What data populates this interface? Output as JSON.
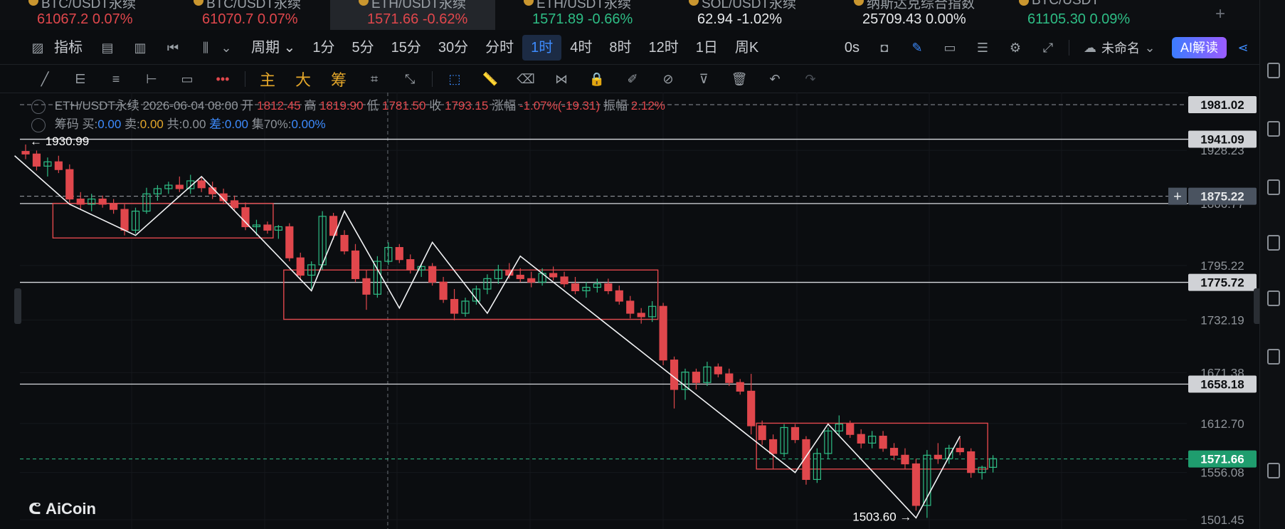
{
  "tickers": [
    {
      "name": "BTC/USDT永续",
      "price": "61067.2",
      "change": "0.07%",
      "dir": "down"
    },
    {
      "name": "BTC/USDT永续",
      "price": "61070.7",
      "change": "0.07%",
      "dir": "down"
    },
    {
      "name": "ETH/USDT永续",
      "price": "1571.66",
      "change": "-0.62%",
      "dir": "down",
      "active": true
    },
    {
      "name": "ETH/USDT永续",
      "price": "1571.89",
      "change": "-0.66%",
      "dir": "up"
    },
    {
      "name": "SOL/USDT永续",
      "price": "62.94",
      "change": "-1.02%",
      "dir": "white"
    },
    {
      "name": "纳斯达克综合指数",
      "price": "25709.43",
      "change": "0.00%",
      "dir": "white"
    },
    {
      "name": "BTC/USDT",
      "price": "61105.30",
      "change": "0.09%",
      "dir": "up"
    }
  ],
  "toolbar": {
    "indicator_label": "指标",
    "period_label": "周期",
    "intervals": [
      "1分",
      "5分",
      "15分",
      "30分",
      "分时",
      "1时",
      "4时",
      "8时",
      "12时",
      "1日",
      "周K"
    ],
    "selected_interval": "1时",
    "countdown": "0s",
    "layout_name": "未命名",
    "ai_label": "AI解读"
  },
  "toolbar2": {
    "zhu": "主",
    "da": "大",
    "chou": "筹"
  },
  "legend": {
    "symbol": "ETH/USDT永续",
    "datetime": "2026-06-04 08:00",
    "open_label": "开",
    "open": "1812.45",
    "high_label": "高",
    "high": "1819.90",
    "low_label": "低",
    "low": "1781.50",
    "close_label": "收",
    "close": "1793.15",
    "change_label": "涨幅",
    "change": "-1.07%(-19.31)",
    "amp_label": "振幅",
    "amp": "2.12%"
  },
  "legend2": {
    "title": "筹码",
    "buy_label": "买:",
    "buy": "0.00",
    "sell_label": "卖:",
    "sell": "0.00",
    "total_label": "共:",
    "total": "0.00",
    "diff_label": "差:",
    "diff": "0.00",
    "conc_label": "集70%:",
    "conc": "0.00%"
  },
  "chart_data": {
    "type": "candlestick",
    "symbol": "ETH/USDT永续",
    "interval": "1h",
    "ylim": [
      1490,
      2000
    ],
    "y_ticks": [
      "1928.23",
      "1866.77",
      "1795.22",
      "1732.19",
      "1671.38",
      "1612.70",
      "1556.08",
      "1501.45"
    ],
    "candles": [
      {
        "o": 1927,
        "h": 1935,
        "l": 1918,
        "c": 1924
      },
      {
        "o": 1924,
        "h": 1928,
        "l": 1905,
        "c": 1910
      },
      {
        "o": 1910,
        "h": 1920,
        "l": 1898,
        "c": 1915
      },
      {
        "o": 1915,
        "h": 1922,
        "l": 1902,
        "c": 1906
      },
      {
        "o": 1906,
        "h": 1912,
        "l": 1868,
        "c": 1872
      },
      {
        "o": 1872,
        "h": 1880,
        "l": 1860,
        "c": 1866
      },
      {
        "o": 1866,
        "h": 1878,
        "l": 1858,
        "c": 1872
      },
      {
        "o": 1872,
        "h": 1876,
        "l": 1862,
        "c": 1866
      },
      {
        "o": 1866,
        "h": 1872,
        "l": 1855,
        "c": 1860
      },
      {
        "o": 1860,
        "h": 1866,
        "l": 1830,
        "c": 1836
      },
      {
        "o": 1836,
        "h": 1862,
        "l": 1832,
        "c": 1858
      },
      {
        "o": 1858,
        "h": 1885,
        "l": 1855,
        "c": 1878
      },
      {
        "o": 1878,
        "h": 1888,
        "l": 1870,
        "c": 1884
      },
      {
        "o": 1884,
        "h": 1892,
        "l": 1878,
        "c": 1888
      },
      {
        "o": 1888,
        "h": 1898,
        "l": 1880,
        "c": 1884
      },
      {
        "o": 1884,
        "h": 1900,
        "l": 1878,
        "c": 1893
      },
      {
        "o": 1893,
        "h": 1898,
        "l": 1880,
        "c": 1885
      },
      {
        "o": 1885,
        "h": 1892,
        "l": 1872,
        "c": 1878
      },
      {
        "o": 1878,
        "h": 1884,
        "l": 1866,
        "c": 1870
      },
      {
        "o": 1870,
        "h": 1876,
        "l": 1858,
        "c": 1862
      },
      {
        "o": 1862,
        "h": 1868,
        "l": 1836,
        "c": 1840
      },
      {
        "o": 1840,
        "h": 1848,
        "l": 1830,
        "c": 1842
      },
      {
        "o": 1842,
        "h": 1846,
        "l": 1832,
        "c": 1836
      },
      {
        "o": 1836,
        "h": 1842,
        "l": 1826,
        "c": 1840
      },
      {
        "o": 1840,
        "h": 1844,
        "l": 1800,
        "c": 1804
      },
      {
        "o": 1804,
        "h": 1810,
        "l": 1778,
        "c": 1784
      },
      {
        "o": 1784,
        "h": 1800,
        "l": 1768,
        "c": 1796
      },
      {
        "o": 1796,
        "h": 1858,
        "l": 1790,
        "c": 1852
      },
      {
        "o": 1852,
        "h": 1856,
        "l": 1825,
        "c": 1830
      },
      {
        "o": 1830,
        "h": 1836,
        "l": 1808,
        "c": 1812
      },
      {
        "o": 1812,
        "h": 1820,
        "l": 1776,
        "c": 1780
      },
      {
        "o": 1780,
        "h": 1790,
        "l": 1744,
        "c": 1762
      },
      {
        "o": 1762,
        "h": 1806,
        "l": 1758,
        "c": 1800
      },
      {
        "o": 1800,
        "h": 1822,
        "l": 1796,
        "c": 1816
      },
      {
        "o": 1816,
        "h": 1820,
        "l": 1798,
        "c": 1802
      },
      {
        "o": 1802,
        "h": 1808,
        "l": 1786,
        "c": 1790
      },
      {
        "o": 1790,
        "h": 1796,
        "l": 1782,
        "c": 1794
      },
      {
        "o": 1794,
        "h": 1798,
        "l": 1772,
        "c": 1776
      },
      {
        "o": 1776,
        "h": 1782,
        "l": 1752,
        "c": 1756
      },
      {
        "o": 1756,
        "h": 1768,
        "l": 1732,
        "c": 1740
      },
      {
        "o": 1740,
        "h": 1758,
        "l": 1736,
        "c": 1754
      },
      {
        "o": 1754,
        "h": 1772,
        "l": 1750,
        "c": 1768
      },
      {
        "o": 1768,
        "h": 1785,
        "l": 1762,
        "c": 1780
      },
      {
        "o": 1780,
        "h": 1796,
        "l": 1774,
        "c": 1790
      },
      {
        "o": 1790,
        "h": 1798,
        "l": 1780,
        "c": 1784
      },
      {
        "o": 1784,
        "h": 1792,
        "l": 1776,
        "c": 1780
      },
      {
        "o": 1780,
        "h": 1788,
        "l": 1770,
        "c": 1776
      },
      {
        "o": 1776,
        "h": 1792,
        "l": 1772,
        "c": 1786
      },
      {
        "o": 1786,
        "h": 1794,
        "l": 1778,
        "c": 1782
      },
      {
        "o": 1782,
        "h": 1788,
        "l": 1770,
        "c": 1774
      },
      {
        "o": 1774,
        "h": 1782,
        "l": 1762,
        "c": 1766
      },
      {
        "o": 1766,
        "h": 1776,
        "l": 1758,
        "c": 1770
      },
      {
        "o": 1770,
        "h": 1780,
        "l": 1764,
        "c": 1774
      },
      {
        "o": 1774,
        "h": 1780,
        "l": 1762,
        "c": 1766
      },
      {
        "o": 1766,
        "h": 1772,
        "l": 1750,
        "c": 1754
      },
      {
        "o": 1754,
        "h": 1760,
        "l": 1734,
        "c": 1740
      },
      {
        "o": 1740,
        "h": 1746,
        "l": 1728,
        "c": 1736
      },
      {
        "o": 1736,
        "h": 1754,
        "l": 1730,
        "c": 1748
      },
      {
        "o": 1748,
        "h": 1752,
        "l": 1680,
        "c": 1686
      },
      {
        "o": 1686,
        "h": 1690,
        "l": 1630,
        "c": 1652
      },
      {
        "o": 1652,
        "h": 1676,
        "l": 1640,
        "c": 1672
      },
      {
        "o": 1672,
        "h": 1676,
        "l": 1652,
        "c": 1660
      },
      {
        "o": 1660,
        "h": 1684,
        "l": 1656,
        "c": 1678
      },
      {
        "o": 1678,
        "h": 1682,
        "l": 1666,
        "c": 1670
      },
      {
        "o": 1670,
        "h": 1676,
        "l": 1656,
        "c": 1660
      },
      {
        "o": 1660,
        "h": 1664,
        "l": 1646,
        "c": 1650
      },
      {
        "o": 1650,
        "h": 1670,
        "l": 1600,
        "c": 1610
      },
      {
        "o": 1610,
        "h": 1616,
        "l": 1588,
        "c": 1594
      },
      {
        "o": 1594,
        "h": 1600,
        "l": 1560,
        "c": 1578
      },
      {
        "o": 1578,
        "h": 1612,
        "l": 1574,
        "c": 1608
      },
      {
        "o": 1608,
        "h": 1612,
        "l": 1590,
        "c": 1594
      },
      {
        "o": 1594,
        "h": 1598,
        "l": 1542,
        "c": 1548
      },
      {
        "o": 1548,
        "h": 1584,
        "l": 1544,
        "c": 1578
      },
      {
        "o": 1578,
        "h": 1608,
        "l": 1572,
        "c": 1604
      },
      {
        "o": 1604,
        "h": 1622,
        "l": 1598,
        "c": 1612
      },
      {
        "o": 1612,
        "h": 1616,
        "l": 1596,
        "c": 1600
      },
      {
        "o": 1600,
        "h": 1606,
        "l": 1584,
        "c": 1590
      },
      {
        "o": 1590,
        "h": 1604,
        "l": 1584,
        "c": 1598
      },
      {
        "o": 1598,
        "h": 1604,
        "l": 1580,
        "c": 1584
      },
      {
        "o": 1584,
        "h": 1590,
        "l": 1570,
        "c": 1576
      },
      {
        "o": 1576,
        "h": 1584,
        "l": 1560,
        "c": 1566
      },
      {
        "o": 1566,
        "h": 1572,
        "l": 1512,
        "c": 1518
      },
      {
        "o": 1518,
        "h": 1582,
        "l": 1503.6,
        "c": 1576
      },
      {
        "o": 1576,
        "h": 1590,
        "l": 1566,
        "c": 1572
      },
      {
        "o": 1572,
        "h": 1588,
        "l": 1566,
        "c": 1584
      },
      {
        "o": 1584,
        "h": 1596,
        "l": 1576,
        "c": 1580
      },
      {
        "o": 1580,
        "h": 1584,
        "l": 1550,
        "c": 1556
      },
      {
        "o": 1556,
        "h": 1564,
        "l": 1548,
        "c": 1562
      },
      {
        "o": 1562,
        "h": 1576,
        "l": 1556,
        "c": 1572
      }
    ],
    "h_lines": [
      1941.09,
      1875.22,
      1866.77,
      1775.72,
      1658.18
    ],
    "current_price": 1571.66,
    "price_labels": [
      {
        "value": 1981.02,
        "text": "1981.02",
        "kind": "gray"
      },
      {
        "value": 1941.09,
        "text": "1941.09",
        "kind": "gray"
      },
      {
        "value": 1875.22,
        "text": "1875.22",
        "kind": "crosshair"
      },
      {
        "value": 1775.72,
        "text": "1775.72",
        "kind": "gray"
      },
      {
        "value": 1658.18,
        "text": "1658.18",
        "kind": "gray"
      },
      {
        "value": 1571.66,
        "text": "1571.66",
        "kind": "current"
      }
    ],
    "annotations": [
      {
        "text": "← 1930.99",
        "value": 1930.99,
        "index": 0,
        "side": "left"
      },
      {
        "text": "1503.60 →",
        "value": 1503.6,
        "index": 81,
        "side": "right"
      }
    ],
    "boxes": [
      {
        "from": 3,
        "to": 22,
        "top": 1867,
        "bottom": 1827
      },
      {
        "from": 24,
        "to": 57,
        "top": 1790,
        "bottom": 1733
      },
      {
        "from": 67,
        "to": 87,
        "top": 1613,
        "bottom": 1560
      }
    ],
    "zigzag": [
      {
        "i": -1,
        "v": 1922
      },
      {
        "i": 4,
        "v": 1866
      },
      {
        "i": 10,
        "v": 1830
      },
      {
        "i": 16,
        "v": 1898
      },
      {
        "i": 26,
        "v": 1766
      },
      {
        "i": 29,
        "v": 1858
      },
      {
        "i": 34,
        "v": 1746
      },
      {
        "i": 37,
        "v": 1822
      },
      {
        "i": 42,
        "v": 1740
      },
      {
        "i": 45,
        "v": 1806
      },
      {
        "i": 70,
        "v": 1556
      },
      {
        "i": 73,
        "v": 1612
      },
      {
        "i": 81,
        "v": 1503.6
      },
      {
        "i": 85,
        "v": 1598
      }
    ],
    "crosshair_index": 31
  }
}
